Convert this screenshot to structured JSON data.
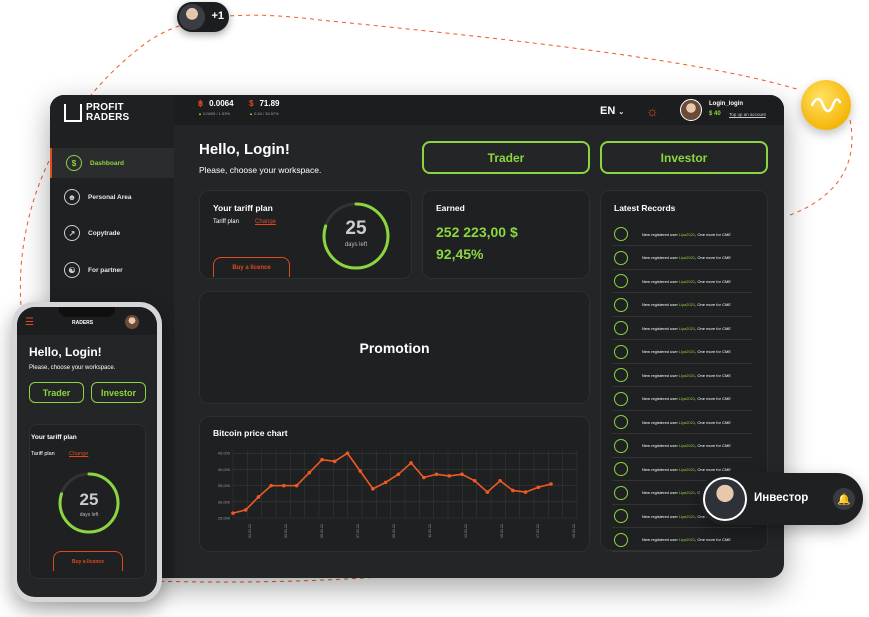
{
  "floating": {
    "top_avatar_count": "+1"
  },
  "dashboard": {
    "logo": {
      "line1": "PROFIT",
      "line2": "RADERS"
    },
    "sidebar": {
      "items": [
        {
          "label": "Dashboard",
          "icon": "dollar-circle-icon",
          "active": true
        },
        {
          "label": "Personal Area",
          "icon": "user-circle-icon"
        },
        {
          "label": "Copytrade",
          "icon": "chart-line-icon"
        },
        {
          "label": "For partner",
          "icon": "people-icon"
        }
      ]
    },
    "topbar": {
      "ticker_btc": {
        "symbol": "฿",
        "value": "0.0064",
        "sub_change": "0.0005",
        "sub_pct": "/ 1.53%"
      },
      "ticker_usd": {
        "symbol": "$",
        "value": "71.89",
        "sub_change": "0.34",
        "sub_pct": "/ 30.57%"
      },
      "lang": "EN",
      "user_name": "Login_login",
      "balance": "$ 40",
      "topup": "Top up an account"
    },
    "hello": "Hello, Login!",
    "choose": "Please, choose your workspace.",
    "buttons": {
      "trader": "Trader",
      "investor": "Investor"
    },
    "tariff": {
      "title": "Your tariff plan",
      "plan_label": "Tariff plan",
      "change": "Change",
      "buy": "Buy a licence",
      "days": "25",
      "days_label": "days left",
      "progress": 0.8
    },
    "earned": {
      "title": "Earned",
      "amount": "252 223,00 $",
      "percent": "92,45%"
    },
    "promotion": "Promotion",
    "latest": {
      "title": "Latest Records",
      "record_prefix": "New registered user",
      "record_user": "Liya2021",
      "record_suffix": ", One more for CME",
      "count": 14
    },
    "chart": {
      "title": "Bitcoin price chart"
    }
  },
  "chart_data": {
    "type": "line",
    "title": "Bitcoin price chart",
    "xlabel": "",
    "ylabel": "",
    "y_ticks": [
      "45,000",
      "40,000",
      "35,000",
      "30,000",
      "25,000"
    ],
    "x_ticks": [
      "01.01.21",
      "03.01.21",
      "05.01.21",
      "07.01.21",
      "09.01.21",
      "11.01.21",
      "13.01.21",
      "15.01.21",
      "17.01.21",
      "19.01.21"
    ],
    "ylim": [
      25000,
      46000
    ],
    "values": [
      26500,
      27500,
      31500,
      35000,
      35000,
      35000,
      39000,
      43000,
      42500,
      45000,
      39500,
      34000,
      36000,
      38500,
      42000,
      37500,
      38500,
      38000,
      38500,
      36500,
      33000,
      36500,
      33500,
      33000,
      34500,
      35500
    ],
    "color": "#f05a22",
    "grid": true
  },
  "phone": {
    "logo": "RADERS",
    "hello": "Hello, Login!",
    "choose": "Please, choose your workspace.",
    "trader": "Trader",
    "investor": "Investor",
    "tariff_title": "Your tariff plan",
    "plan_label": "Tariff plan",
    "change": "Change",
    "days": "25",
    "days_label": "days left",
    "buy": "Buy a licence"
  },
  "investor_pill": {
    "label": "Инвестор"
  },
  "colors": {
    "accent_green": "#8bd640",
    "accent_orange": "#e04a1f",
    "bg": "#242527"
  }
}
